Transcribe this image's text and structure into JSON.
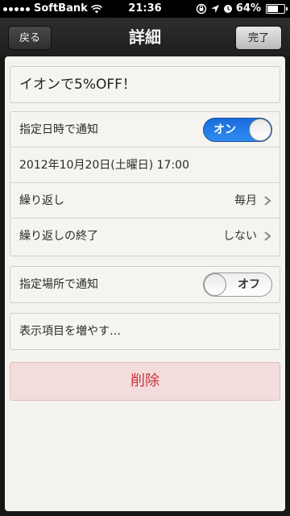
{
  "status_bar": {
    "carrier": "SoftBank",
    "time": "21:36",
    "battery": "64%",
    "battery_level": 0.64,
    "icons": [
      "signal-dots-icon",
      "wifi-icon",
      "rotation-lock-icon",
      "location-arrow-icon",
      "alarm-icon",
      "battery-icon"
    ]
  },
  "nav": {
    "back_label": "戻る",
    "title": "詳細",
    "done_label": "完了"
  },
  "reminder": {
    "title": "イオンで5%OFF！"
  },
  "date_group": {
    "notify_label": "指定日時で通知",
    "notify_toggle_label": "オン",
    "notify_on": true,
    "datetime": "2012年10月20日(土曜日) 17:00",
    "repeat_label": "繰り返し",
    "repeat_value": "毎月",
    "repeat_end_label": "繰り返しの終了",
    "repeat_end_value": "しない"
  },
  "location_group": {
    "notify_label": "指定場所で通知",
    "notify_toggle_label": "オフ",
    "notify_on": false
  },
  "more_group": {
    "label": "表示項目を増やす…"
  },
  "delete_label": "削除",
  "colors": {
    "toggle_on": "#1a6ddc",
    "delete_text": "#c9303a",
    "delete_bg": "#f3dcdc"
  }
}
